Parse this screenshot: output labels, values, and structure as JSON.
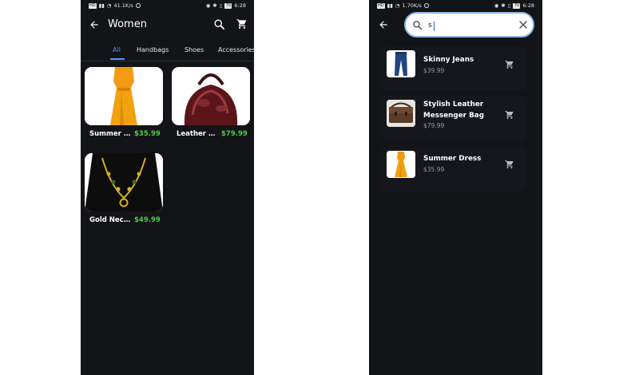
{
  "status_left": {
    "time": "6:28",
    "speed": "41.1K/s",
    "battery": "70"
  },
  "status_right": {
    "time": "6:28",
    "speed": "1.70K/s",
    "battery": "70"
  },
  "category_screen": {
    "title": "Women",
    "tabs": [
      "All",
      "Handbags",
      "Shoes",
      "Accessories"
    ],
    "active_tab": "All",
    "products": [
      {
        "name": "Summer Dress",
        "price": "$35.99",
        "image": "orange-dress"
      },
      {
        "name": "Leather Handbag",
        "price": "$79.99",
        "image": "burgundy-handbag"
      },
      {
        "name": "Gold Necklace",
        "price": "$49.99",
        "image": "gold-necklace"
      }
    ]
  },
  "search_screen": {
    "query": "s",
    "results": [
      {
        "name": "Skinny Jeans",
        "price": "$39.99",
        "image": "jeans"
      },
      {
        "name": "Stylish Leather Messenger Bag",
        "price": "$79.99",
        "image": "messenger-bag"
      },
      {
        "name": "Summer Dress",
        "price": "$35.99",
        "image": "orange-dress"
      }
    ]
  },
  "colors": {
    "background": "#131418",
    "accent": "#4f9ef5",
    "price_green": "#4ccc45",
    "price_grey": "#9a9aa0"
  },
  "icons": [
    "back-arrow-icon",
    "search-icon",
    "shopping-cart-icon",
    "clear-icon"
  ]
}
